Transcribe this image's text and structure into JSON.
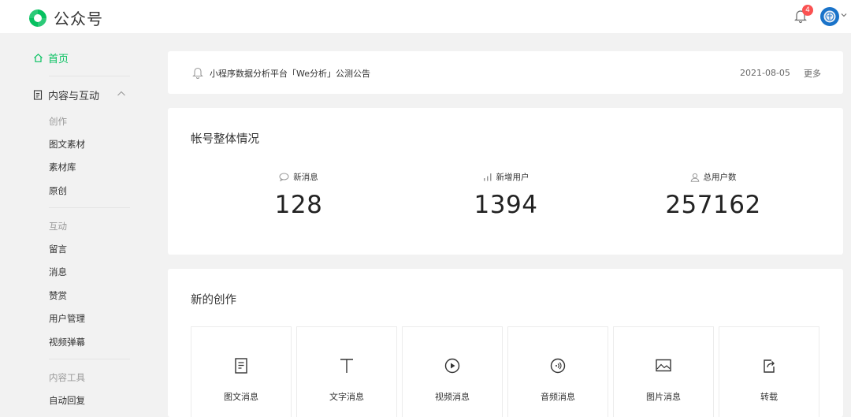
{
  "header": {
    "app_title": "公众号",
    "notification_count": "4",
    "brand_color": "#07c160"
  },
  "sidebar": {
    "home": "首页",
    "group_label": "内容与互动",
    "sections": [
      {
        "category": "创作",
        "items": [
          "图文素材",
          "素材库",
          "原创"
        ]
      },
      {
        "category": "互动",
        "items": [
          "留言",
          "消息",
          "赞赏",
          "用户管理",
          "视频弹幕"
        ]
      },
      {
        "category": "内容工具",
        "items": [
          "自动回复"
        ]
      }
    ]
  },
  "notice": {
    "text": "小程序数据分析平台「We分析」公测公告",
    "date": "2021-08-05",
    "more": "更多"
  },
  "overview": {
    "title": "帐号整体情况",
    "stats": [
      {
        "label": "新消息",
        "value": "128",
        "icon": "chat-bubble-icon"
      },
      {
        "label": "新增用户",
        "value": "1394",
        "icon": "bar-chart-icon"
      },
      {
        "label": "总用户数",
        "value": "257162",
        "icon": "user-icon"
      }
    ]
  },
  "creation": {
    "title": "新的创作",
    "tiles": [
      {
        "label": "图文消息",
        "icon": "document-icon"
      },
      {
        "label": "文字消息",
        "icon": "text-icon"
      },
      {
        "label": "视频消息",
        "icon": "video-play-icon"
      },
      {
        "label": "音频消息",
        "icon": "audio-icon"
      },
      {
        "label": "图片消息",
        "icon": "image-icon"
      },
      {
        "label": "转载",
        "icon": "share-icon"
      }
    ]
  }
}
